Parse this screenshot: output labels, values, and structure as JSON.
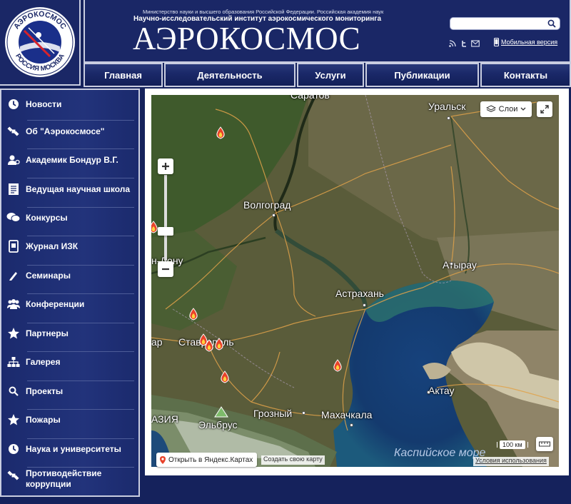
{
  "logo": {
    "arc_top": "АЭРОКОСМОС",
    "arc_bottom": "РОССИЯ МОСКВА"
  },
  "header": {
    "ministry_line": "Министерство науки и высшего образования Российской Федерации. Российская академия наук",
    "institute_line": "Научно-исследовательский институт аэрокосмического мониторинга",
    "title": "АЭРОКОСМОС",
    "search_value": "",
    "mobile_version": "Мобильная версия"
  },
  "nav": {
    "items": [
      {
        "label": "Главная"
      },
      {
        "label": "Деятельность"
      },
      {
        "label": "Услуги"
      },
      {
        "label": "Публикации"
      },
      {
        "label": "Контакты"
      }
    ]
  },
  "sidebar": {
    "items": [
      {
        "label": "Новости",
        "icon": "clock-icon"
      },
      {
        "label": "Об \"Аэрокосмосе\"",
        "icon": "satellite-icon"
      },
      {
        "label": "Академик Бондур В.Г.",
        "icon": "user-icon"
      },
      {
        "label": "Ведущая научная школа",
        "icon": "document-icon"
      },
      {
        "label": "Конкурсы",
        "icon": "chat-icon"
      },
      {
        "label": "Журнал ИЗК",
        "icon": "journal-icon"
      },
      {
        "label": "Семинары",
        "icon": "pen-icon"
      },
      {
        "label": "Конференции",
        "icon": "group-icon"
      },
      {
        "label": "Партнеры",
        "icon": "star-icon"
      },
      {
        "label": "Галерея",
        "icon": "sitemap-icon"
      },
      {
        "label": "Проекты",
        "icon": "search-icon"
      },
      {
        "label": "Пожары",
        "icon": "star-icon"
      },
      {
        "label": "Наука и университеты",
        "icon": "clock-icon"
      },
      {
        "label": "Противодействие коррупции",
        "icon": "satellite-icon"
      }
    ]
  },
  "map": {
    "layers_label": "Слои",
    "open_in_yandex": "Открыть в Яндекс.Картах",
    "create_map": "Создать свою карту",
    "scale_label": "100 км",
    "terms": "Условия использования",
    "cities": {
      "saratov": "Саратов",
      "uralsk": "Уральск",
      "volgograd": "Волгоград",
      "rostov_partial": "н-Дону",
      "atyrau": "Атырау",
      "astrakhan": "Астрахань",
      "krasnodar_partial": "ар",
      "stavropol": "Ставрополь",
      "aktau": "Актау",
      "abkhazia_partial": "АЗИЯ",
      "elbrus": "Эльбрус",
      "grozny": "Грозный",
      "makhachkala": "Махачкала"
    },
    "sea_label": "Каспийское море"
  }
}
